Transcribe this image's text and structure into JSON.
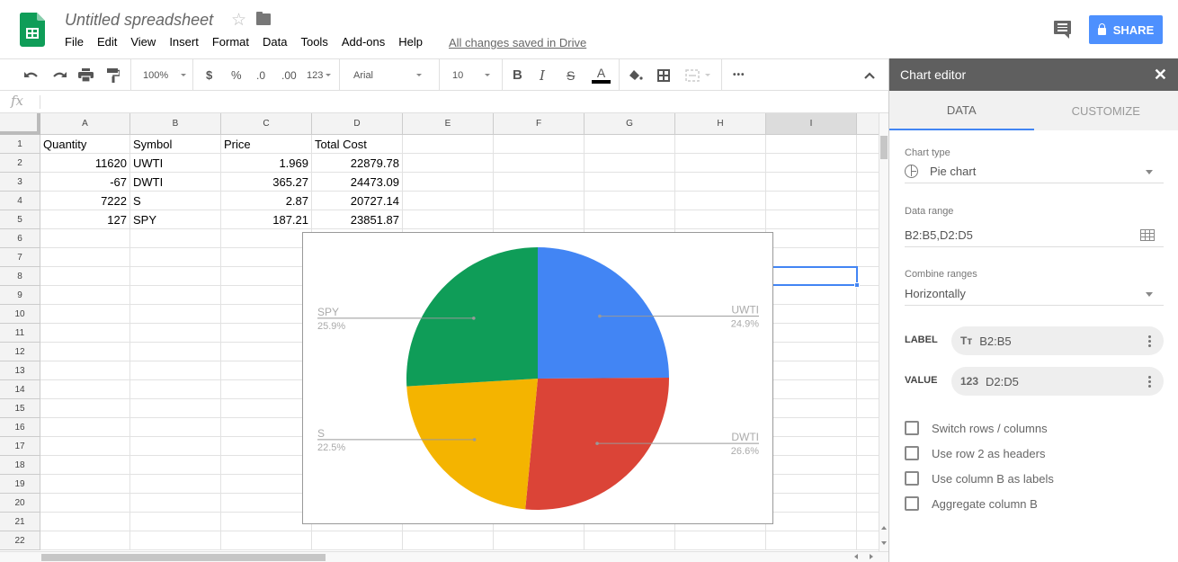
{
  "app": {
    "doc_title": "Untitled spreadsheet",
    "menu": [
      "File",
      "Edit",
      "View",
      "Insert",
      "Format",
      "Data",
      "Tools",
      "Add-ons",
      "Help"
    ],
    "save_status": "All changes saved in Drive",
    "share_label": "SHARE",
    "brand_color": "#0f9d58",
    "accent_color": "#4d90fe"
  },
  "toolbar": {
    "zoom": "100%",
    "currency": "$",
    "percent": "%",
    "decrease_decimals": ".0",
    "increase_decimals": ".00",
    "more_formats": "123",
    "font": "Arial",
    "font_size": "10",
    "more": "•••"
  },
  "formula_bar": {
    "fx": "fx",
    "value": ""
  },
  "sheet": {
    "columns": [
      "A",
      "B",
      "C",
      "D",
      "E",
      "F",
      "G",
      "H",
      "I"
    ],
    "rows": [
      "1",
      "2",
      "3",
      "4",
      "5",
      "6",
      "7",
      "8",
      "9",
      "10",
      "11",
      "12",
      "13",
      "14",
      "15",
      "16",
      "17",
      "18",
      "19",
      "20",
      "21",
      "22"
    ],
    "header_row": [
      "Quantity",
      "Symbol",
      "Price",
      "Total Cost"
    ],
    "data": [
      [
        "11620",
        "UWTI",
        "1.969",
        "22879.78"
      ],
      [
        "-67",
        "DWTI",
        "365.27",
        "24473.09"
      ],
      [
        "7222",
        "S",
        "2.87",
        "20727.14"
      ],
      [
        "127",
        "SPY",
        "187.21",
        "23851.87"
      ]
    ]
  },
  "chart_data": {
    "type": "pie",
    "title": "",
    "categories": [
      "UWTI",
      "DWTI",
      "S",
      "SPY"
    ],
    "values": [
      22879.78,
      24473.09,
      20727.14,
      23851.87
    ],
    "percent_labels": [
      "24.9%",
      "26.6%",
      "22.5%",
      "25.9%"
    ],
    "colors": [
      "#4285f4",
      "#db4437",
      "#f4b400",
      "#0f9d58"
    ],
    "legend": "labeled",
    "label_color": "#aaaaaa"
  },
  "editor": {
    "title": "Chart editor",
    "tabs": [
      {
        "label": "DATA",
        "active": true
      },
      {
        "label": "CUSTOMIZE",
        "active": false
      }
    ],
    "chart_type_label": "Chart type",
    "chart_type_value": "Pie chart",
    "data_range_label": "Data range",
    "data_range_value": "B2:B5,D2:D5",
    "combine_label": "Combine ranges",
    "combine_value": "Horizontally",
    "label_series_label": "LABEL",
    "label_series_icon": "Tт",
    "label_series_value": "B2:B5",
    "value_series_label": "VALUE",
    "value_series_icon": "123",
    "value_series_value": "D2:D5",
    "checkboxes": [
      {
        "label": "Switch rows / columns",
        "checked": false
      },
      {
        "label": "Use row 2 as headers",
        "checked": false
      },
      {
        "label": "Use column B as labels",
        "checked": false
      },
      {
        "label": "Aggregate column B",
        "checked": false
      }
    ]
  }
}
